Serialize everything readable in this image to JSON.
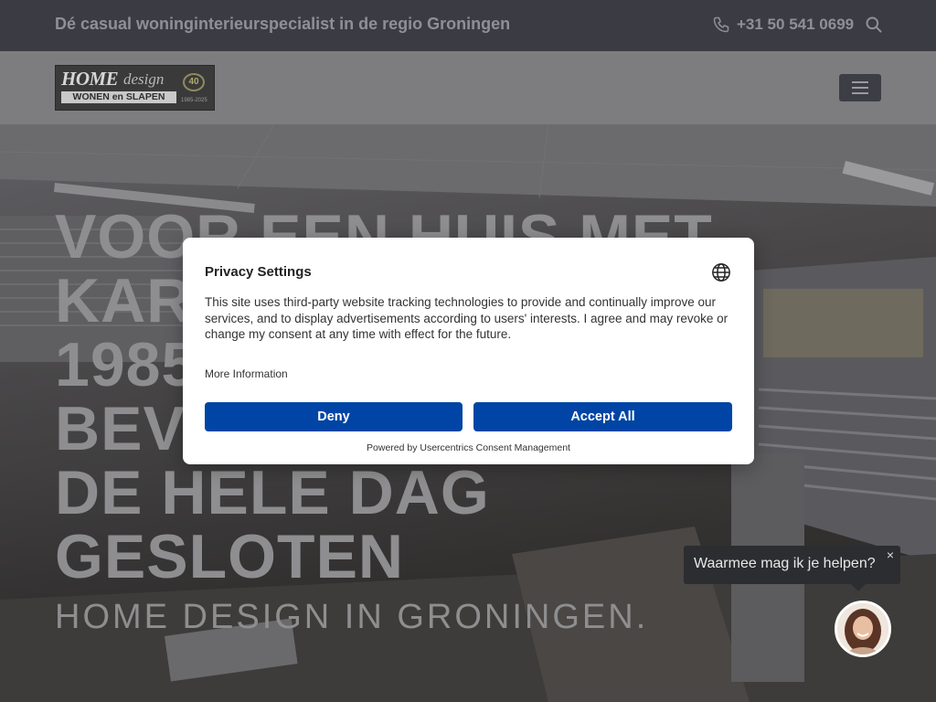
{
  "topbar": {
    "tagline": "Dé casual woninginterieurspecialist in de regio Groningen",
    "phone": "+31 50 541 0699",
    "phone_icon": "phone-icon",
    "search_icon": "search-icon"
  },
  "header": {
    "logo": {
      "home": "HOME",
      "design": "design",
      "badge": "40",
      "wonen": "WONEN en SLAPEN",
      "years": "1985-2025"
    },
    "menu_icon": "hamburger-menu-icon"
  },
  "hero": {
    "title": "VOOR EEN HUIS MET KARAKTER SINDS 1985 5 MEI BEVRIJDINGSDAG DE HELE DAG GESLOTEN",
    "subtitle": "HOME DESIGN IN GRONINGEN."
  },
  "consent": {
    "title": "Privacy Settings",
    "text": "This site uses third-party website tracking technologies to provide and continually improve our services, and to display advertisements according to users' interests. I agree and may revoke or change my consent at any time with effect for the future.",
    "more_info": "More Information",
    "deny_label": "Deny",
    "accept_label": "Accept All",
    "powered_by": "Powered by Usercentrics Consent Management",
    "globe_icon": "globe-icon",
    "button_color": "#0045a5"
  },
  "chat": {
    "prompt": "Waarmee mag ik je helpen?",
    "close_label": "×"
  },
  "colors": {
    "topbar_bg": "#3b3c43",
    "header_bg": "#7d7d80",
    "overlay_text": "#8e8e90"
  }
}
